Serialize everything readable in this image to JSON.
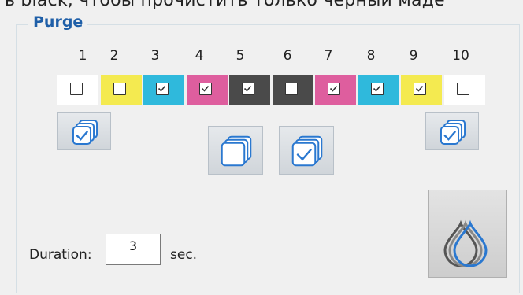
{
  "background_text": "ь black, чтобы прочистить только черный маде",
  "purge": {
    "title": "Purge",
    "channels": [
      {
        "number": "1",
        "color": "#ffffff",
        "checked": false
      },
      {
        "number": "2",
        "color": "#f4ea50",
        "checked": false
      },
      {
        "number": "3",
        "color": "#2fb9dc",
        "checked": true
      },
      {
        "number": "4",
        "color": "#de5e9e",
        "checked": true
      },
      {
        "number": "5",
        "color": "#4a4a4a",
        "checked": true
      },
      {
        "number": "6",
        "color": "#4a4a4a",
        "checked": false
      },
      {
        "number": "7",
        "color": "#de5e9e",
        "checked": true
      },
      {
        "number": "8",
        "color": "#2fb9dc",
        "checked": true
      },
      {
        "number": "9",
        "color": "#f4ea50",
        "checked": true
      },
      {
        "number": "10",
        "color": "#ffffff",
        "checked": false
      }
    ],
    "buttons": [
      {
        "name": "select-all-left-button",
        "icon": "select-all-icon"
      },
      {
        "name": "deselect-all-button",
        "icon": "deselect-all-icon"
      },
      {
        "name": "select-all-center-button",
        "icon": "select-all-icon"
      },
      {
        "name": "select-all-right-button",
        "icon": "select-all-icon"
      },
      {
        "name": "purge-button",
        "icon": "ink-drops-icon"
      }
    ],
    "duration": {
      "label": "Duration:",
      "value": "3",
      "unit": "sec."
    }
  },
  "colors": {
    "accent": "#1f5fa8",
    "icon_blue": "#2a78d0"
  }
}
